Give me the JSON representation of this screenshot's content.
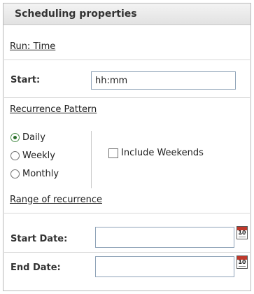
{
  "panel": {
    "title": "Scheduling properties"
  },
  "run_time": {
    "heading": "Run: Time",
    "start_label": "Start:",
    "start_value": "hh:mm"
  },
  "recurrence": {
    "heading": "Recurrence Pattern",
    "options": [
      {
        "label": "Daily",
        "selected": true
      },
      {
        "label": "Weekly",
        "selected": false
      },
      {
        "label": "Monthly",
        "selected": false
      }
    ],
    "include_weekends_label": "Include Weekends",
    "include_weekends_checked": false
  },
  "range": {
    "heading": "Range of recurrence",
    "start_date_label": "Start Date:",
    "start_date_value": "",
    "end_date_label": "End Date:",
    "end_date_value": "",
    "calendar_icon_text": "10"
  },
  "icons": {
    "calendar": "calendar-icon"
  }
}
